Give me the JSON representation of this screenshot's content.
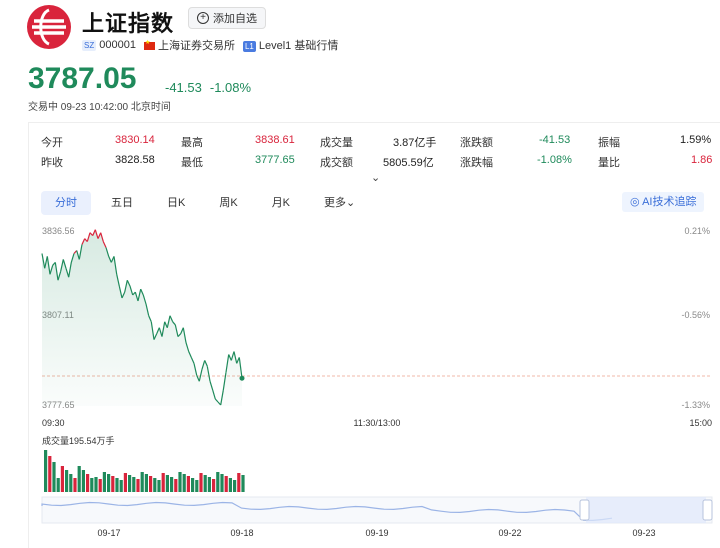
{
  "header": {
    "name": "上证指数",
    "add_label": "添加自选",
    "market_badge": "SZ",
    "code": "000001",
    "exchange": "上海证券交易所",
    "level_badge": "L1",
    "level": "Level1 基础行情",
    "price": "3787.05",
    "change": "-41.53",
    "change_pct": "-1.08%",
    "status": "交易中",
    "datetime": "09-23 10:42:00",
    "timezone": "北京时间"
  },
  "stats": {
    "open_label": "今开",
    "open": "3830.14",
    "high_label": "最高",
    "high": "3838.61",
    "volume_label": "成交量",
    "volume": "3.87亿手",
    "chg_amt_label": "涨跌额",
    "chg_amt": "-41.53",
    "amplitude_label": "振幅",
    "amplitude": "1.59%",
    "prev_label": "昨收",
    "prev": "3828.58",
    "low_label": "最低",
    "low": "3777.65",
    "turnover_label": "成交额",
    "turnover": "5805.59亿",
    "chg_pct_label": "涨跌幅",
    "chg_pct": "-1.08%",
    "vol_ratio_label": "量比",
    "vol_ratio": "1.86"
  },
  "tabs": [
    "分时",
    "五日",
    "日K",
    "周K",
    "月K",
    "更多"
  ],
  "ai_button": "AI技术追踪",
  "colors": {
    "up": "#d9243c",
    "down": "#1f8a5b",
    "accent": "#3a6ed8"
  },
  "chart_data": {
    "type": "line",
    "y_labels_left": [
      "3836.56",
      "3807.11",
      "3777.65"
    ],
    "y_labels_right": [
      "0.21%",
      "-0.56%",
      "-1.33%"
    ],
    "ylim": [
      3777.65,
      3836.56
    ],
    "reference": 3828.58,
    "x_labels": [
      "09:30",
      "11:30/13:00",
      "15:00"
    ],
    "volume_label": "成交量195.54万手",
    "nav_labels": [
      "09-17",
      "09-18",
      "09-19",
      "09-22",
      "09-23"
    ],
    "price_series": [
      3829,
      3824,
      3828,
      3822,
      3825,
      3826,
      3820,
      3823,
      3827,
      3824,
      3821,
      3826,
      3829,
      3830,
      3827,
      3832,
      3834,
      3833,
      3836,
      3835,
      3837,
      3834,
      3836,
      3833,
      3831,
      3828,
      3826,
      3828,
      3822,
      3818,
      3814,
      3816,
      3820,
      3818,
      3815,
      3816,
      3813,
      3817,
      3815,
      3812,
      3808,
      3806,
      3800,
      3802,
      3804,
      3801,
      3806,
      3804,
      3808,
      3806,
      3805,
      3801,
      3802,
      3804,
      3799,
      3796,
      3794,
      3792,
      3788,
      3786,
      3790,
      3793,
      3791,
      3786,
      3783,
      3780,
      3779,
      3778,
      3783,
      3789,
      3795,
      3793,
      3796,
      3792,
      3794,
      3787
    ]
  }
}
